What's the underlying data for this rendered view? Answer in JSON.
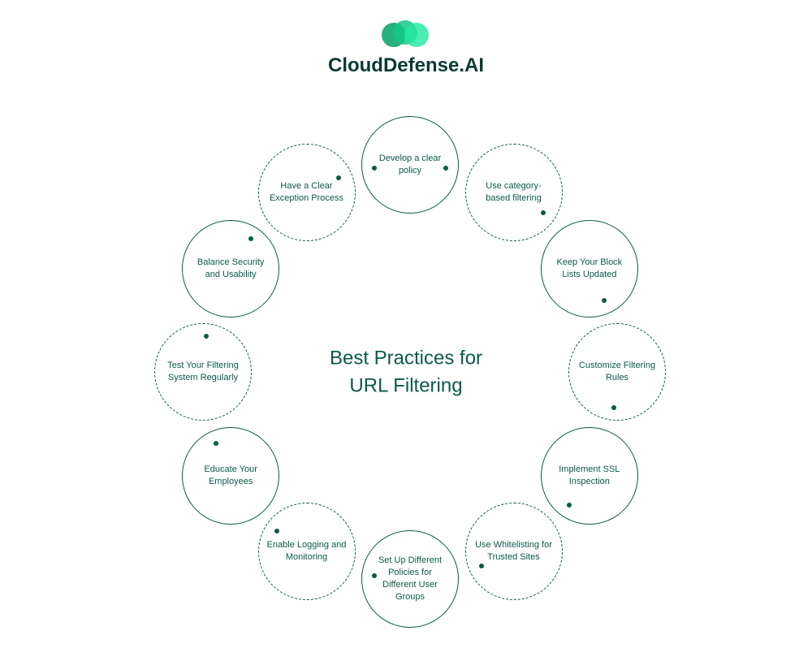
{
  "brand": {
    "name": "CloudDefense.AI"
  },
  "diagram": {
    "title_line1": "Best Practices for",
    "title_line2": "URL Filtering",
    "nodes": [
      {
        "label": "Develop a clear policy"
      },
      {
        "label": "Use category-based filtering"
      },
      {
        "label": "Keep Your Block Lists Updated"
      },
      {
        "label": "Customize Filtering Rules"
      },
      {
        "label": "Implement SSL Inspection"
      },
      {
        "label": "Use Whitelisting for Trusted Sites"
      },
      {
        "label": "Set Up Different Policies for Different User Groups"
      },
      {
        "label": "Enable Logging and Monitoring"
      },
      {
        "label": "Educate Your Employees"
      },
      {
        "label": "Test Your Filtering System Regularly"
      },
      {
        "label": "Balance Security and Usability"
      },
      {
        "label": "Have a Clear Exception Process"
      }
    ]
  },
  "colors": {
    "primary": "#0a5a4a",
    "accent1": "#0fa86f",
    "accent2": "#14c987",
    "accent3": "#1fe9a0"
  }
}
